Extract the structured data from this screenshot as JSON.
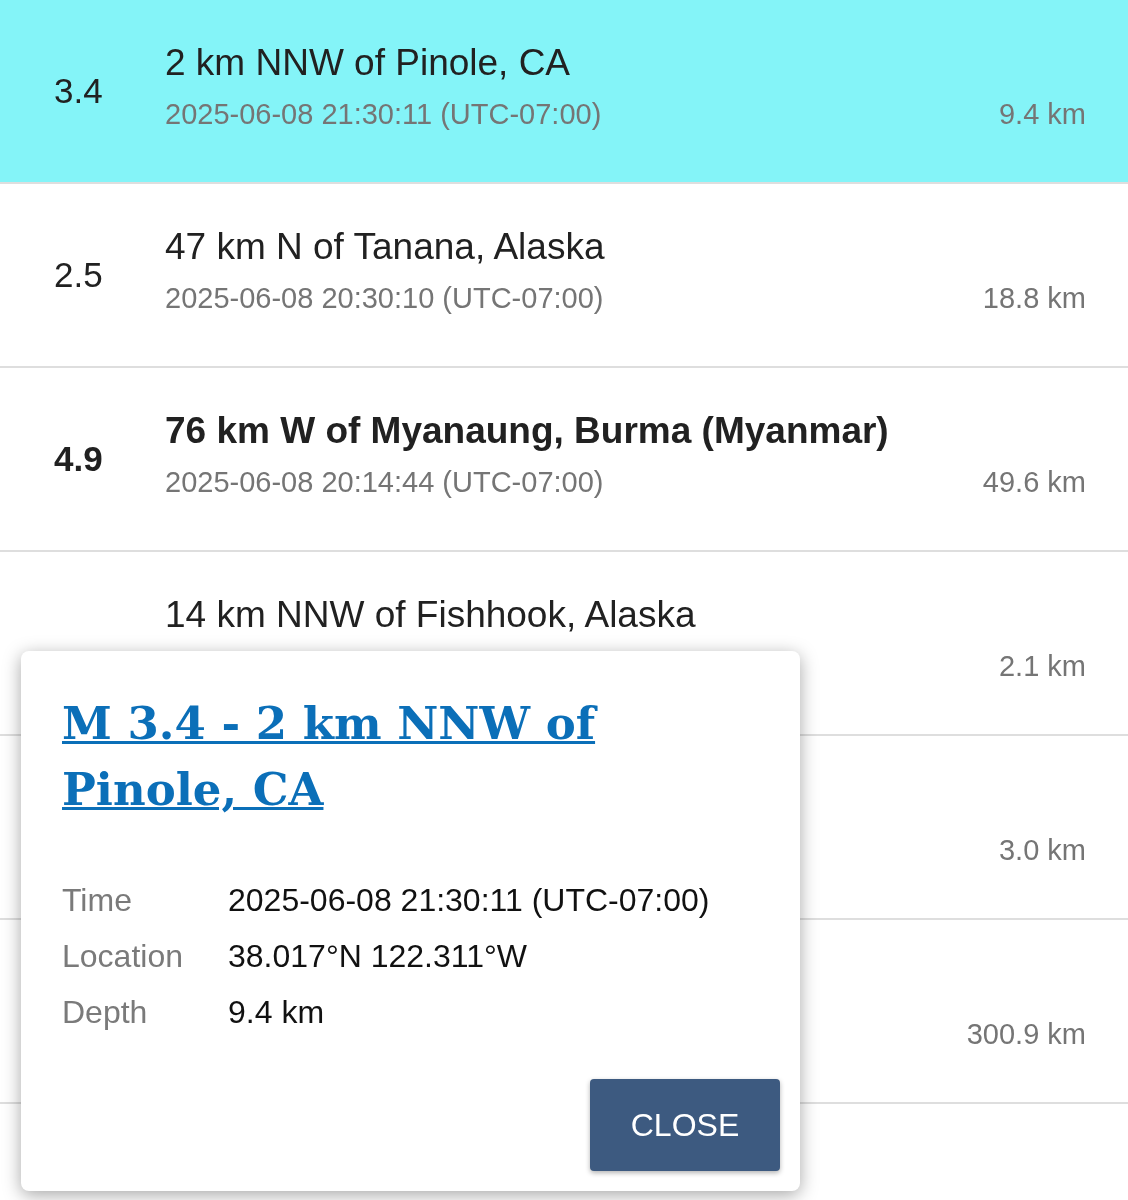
{
  "events": [
    {
      "magnitude": "3.4",
      "place": "2 km NNW of Pinole, CA",
      "time": "2025-06-08 21:30:11 (UTC-07:00)",
      "depth": "9.4 km",
      "selected": true,
      "significant": false
    },
    {
      "magnitude": "2.5",
      "place": "47 km N of Tanana, Alaska",
      "time": "2025-06-08 20:30:10 (UTC-07:00)",
      "depth": "18.8 km",
      "selected": false,
      "significant": false
    },
    {
      "magnitude": "4.9",
      "place": "76 km W of Myanaung, Burma (Myanmar)",
      "time": "2025-06-08 20:14:44 (UTC-07:00)",
      "depth": "49.6 km",
      "selected": false,
      "significant": true
    },
    {
      "place": "14 km NNW of Fishhook, Alaska",
      "depth": "2.1 km",
      "selected": false,
      "significant": false
    },
    {
      "depth": "3.0 km",
      "selected": false
    },
    {
      "depth": "300.9 km",
      "selected": false
    }
  ],
  "popup": {
    "title": "M 3.4 - 2 km NNW of Pinole, CA",
    "details": [
      {
        "label": "Time",
        "value": "2025-06-08 21:30:11 (UTC-07:00)"
      },
      {
        "label": "Location",
        "value": "38.017°N 122.311°W"
      },
      {
        "label": "Depth",
        "value": "9.4 km"
      }
    ],
    "button": "CLOSE"
  }
}
